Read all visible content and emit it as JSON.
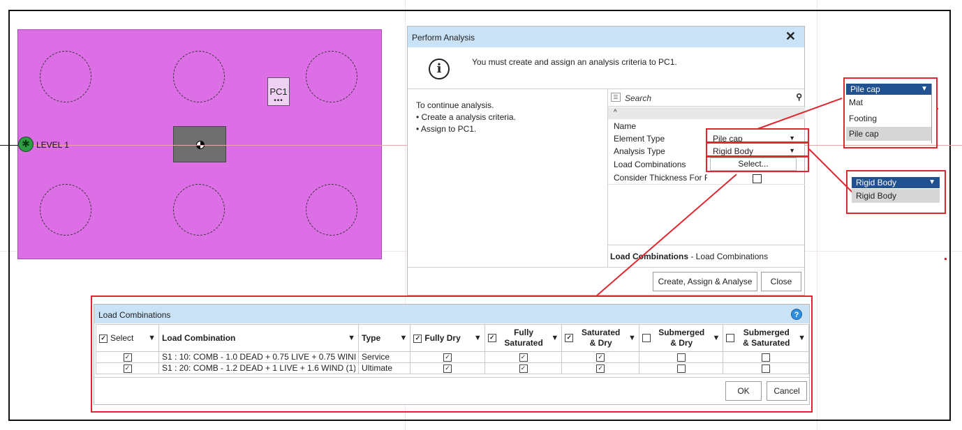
{
  "canvas": {
    "level_label": "LEVEL 1",
    "pile_cap_label": "PC1",
    "pile_cap_dots": "•••"
  },
  "dialog": {
    "title": "Perform  Analysis",
    "close_glyph": "✕",
    "message": "You must create and assign an analysis criteria to PC1.",
    "instructions": {
      "heading": "To continue analysis.",
      "step1": "• Create a analysis criteria.",
      "step2": "• Assign to PC1."
    },
    "properties": {
      "search_placeholder": "Search",
      "search_icon": "magnifier-icon",
      "collapse_glyph": "^",
      "name_label": "Name",
      "element_type_label": "Element Type",
      "element_type_value": "Pile cap",
      "analysis_type_label": "Analysis Type",
      "analysis_type_value": "Rigid Body",
      "load_combinations_label": "Load Combinations",
      "load_combinations_button": "Select...",
      "consider_thickness_label": "Consider Thickness For F",
      "footer_bold": "Load Combinations",
      "footer_rest": " - Load Combinations"
    },
    "buttons": {
      "create": "Create, Assign & Analyse",
      "close": "Close"
    }
  },
  "element_type_dropdown": {
    "selected": "Pile cap",
    "options": [
      "Mat",
      "Footing",
      "Pile cap"
    ]
  },
  "analysis_type_dropdown": {
    "selected": "Rigid Body",
    "options": [
      "Rigid Body"
    ]
  },
  "load_combinations_panel": {
    "title": "Load Combinations",
    "help_glyph": "?",
    "columns": {
      "select": "Select",
      "load_combination": "Load Combination",
      "type": "Type",
      "fully_dry": "Fully Dry",
      "fully_saturated_1": "Fully",
      "fully_saturated_2": "Saturated",
      "saturated_dry_1": "Saturated",
      "saturated_dry_2": "& Dry",
      "submerged_dry_1": "Submerged",
      "submerged_dry_2": "& Dry",
      "submerged_saturated_1": "Submerged",
      "submerged_saturated_2": "& Saturated"
    },
    "rows": [
      {
        "select": true,
        "name": "S1 : 10: COMB - 1.0 DEAD + 0.75 LIVE + 0.75 WINI",
        "type": "Service",
        "fully_dry": true,
        "fully_saturated": true,
        "saturated_dry": true,
        "submerged_dry": false,
        "submerged_saturated": false
      },
      {
        "select": true,
        "name": "S1 : 20: COMB - 1.2 DEAD + 1 LIVE + 1.6 WIND (1)",
        "type": "Ultimate",
        "fully_dry": true,
        "fully_saturated": true,
        "saturated_dry": true,
        "submerged_dry": false,
        "submerged_saturated": false
      }
    ],
    "buttons": {
      "ok": "OK",
      "cancel": "Cancel"
    }
  },
  "colors": {
    "slab": "#dd6fe6",
    "annotation_red": "#e0262e",
    "dialog_title": "#c9e2f6",
    "dropdown_selected": "#21518e"
  }
}
